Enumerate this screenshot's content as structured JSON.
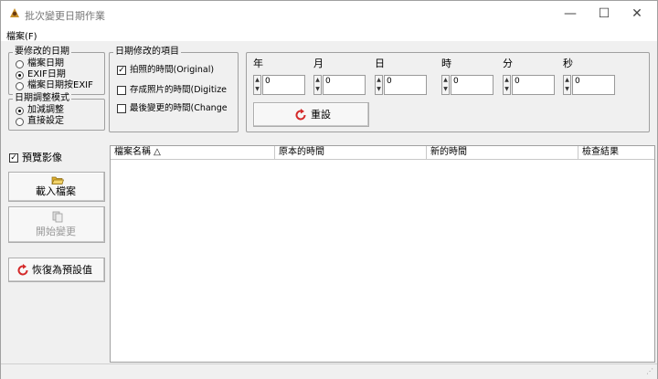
{
  "window": {
    "title": "批次變更日期作業",
    "minimize": "—",
    "maximize": "☐",
    "close": "✕"
  },
  "menu": {
    "file": "檔案(F)"
  },
  "modify_target": {
    "legend": "要修改的日期",
    "options": [
      {
        "label": "檔案日期",
        "selected": false
      },
      {
        "label": "EXIF日期",
        "selected": true
      },
      {
        "label": "檔案日期按EXIF",
        "selected": false
      }
    ]
  },
  "adjust_mode": {
    "legend": "日期調整模式",
    "options": [
      {
        "label": "加減調整",
        "selected": true
      },
      {
        "label": "直接設定",
        "selected": false
      }
    ]
  },
  "items": {
    "legend": "日期修改的項目",
    "options": [
      {
        "label": "拍照的時間(Original)",
        "checked": true
      },
      {
        "label": "存成照片的時間(Digitize",
        "checked": false
      },
      {
        "label": "最後變更的時間(Change",
        "checked": false
      }
    ]
  },
  "time_fields": [
    {
      "label": "年",
      "value": "0"
    },
    {
      "label": "月",
      "value": "0"
    },
    {
      "label": "日",
      "value": "0"
    },
    {
      "label": "時",
      "value": "0"
    },
    {
      "label": "分",
      "value": "0"
    },
    {
      "label": "秒",
      "value": "0"
    }
  ],
  "reset_button": "重設",
  "preview": {
    "label": "預覽影像",
    "checked": true
  },
  "left_buttons": {
    "load": "載入檔案",
    "start": "開始變更",
    "restore": "恢復為預設值"
  },
  "table": {
    "columns": [
      "檔案名稱 △",
      "原本的時間",
      "新的時間",
      "檢查結果"
    ]
  },
  "colors": {
    "accent_red": "#d42a2a",
    "folder_yellow": "#e0b030"
  }
}
